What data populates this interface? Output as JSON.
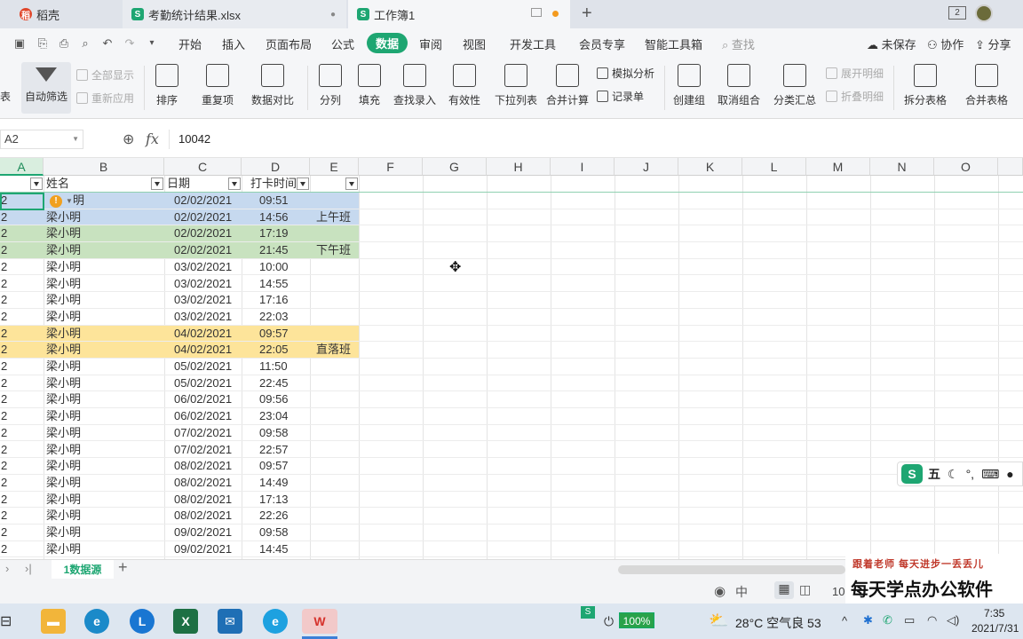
{
  "tabs": [
    {
      "label": "稻壳",
      "icon": "docer-icon",
      "color": "#e0462a"
    },
    {
      "label": "考勤统计结果.xlsx",
      "icon": "spreadsheet-icon",
      "color": "#1ea672"
    },
    {
      "label": "工作簿1",
      "icon": "spreadsheet-icon",
      "color": "#1ea672"
    }
  ],
  "window_badge": "2",
  "menu": {
    "items": [
      "开始",
      "插入",
      "页面布局",
      "公式",
      "数据",
      "审阅",
      "视图",
      "开发工具",
      "会员专享",
      "智能工具箱"
    ],
    "active": "数据",
    "search_placeholder": "查找",
    "unsaved": "未保存",
    "collab": "协作",
    "share": "分享"
  },
  "ribbon": {
    "left_partial": "表",
    "autofilter": "自动筛选",
    "show_all": "全部显示",
    "reapply": "重新应用",
    "sort": "排序",
    "duplicates": "重复项",
    "compare": "数据对比",
    "split_col": "分列",
    "fill": "填充",
    "lookup": "查找录入",
    "validity": "有效性",
    "dropdown": "下拉列表",
    "consolidate": "合并计算",
    "simulate": "模拟分析",
    "record": "记录单",
    "group": "创建组",
    "ungroup": "取消组合",
    "subtotal": "分类汇总",
    "expand": "展开明细",
    "collapse": "折叠明细",
    "split_table": "拆分表格",
    "merge_table": "合并表格"
  },
  "formula_bar": {
    "name_box": "A2",
    "fx": "fx",
    "value": "10042"
  },
  "columns": [
    "A",
    "B",
    "C",
    "D",
    "E",
    "F",
    "G",
    "H",
    "I",
    "J",
    "K",
    "L",
    "M",
    "N",
    "O"
  ],
  "headers": [
    "",
    "姓名",
    "日期",
    "打卡时间",
    ""
  ],
  "rows": [
    {
      "a": "2",
      "name": "明",
      "date": "02/02/2021",
      "time": "09:51",
      "note": "",
      "bg": "#c6d9ef"
    },
    {
      "a": "2",
      "name": "梁小明",
      "date": "02/02/2021",
      "time": "14:56",
      "note": "上午班",
      "bg": "#c6d9ef"
    },
    {
      "a": "2",
      "name": "梁小明",
      "date": "02/02/2021",
      "time": "17:19",
      "note": "",
      "bg": "#c8e2bf"
    },
    {
      "a": "2",
      "name": "梁小明",
      "date": "02/02/2021",
      "time": "21:45",
      "note": "下午班",
      "bg": "#c8e2bf"
    },
    {
      "a": "2",
      "name": "梁小明",
      "date": "03/02/2021",
      "time": "10:00",
      "note": "",
      "bg": ""
    },
    {
      "a": "2",
      "name": "梁小明",
      "date": "03/02/2021",
      "time": "14:55",
      "note": "",
      "bg": ""
    },
    {
      "a": "2",
      "name": "梁小明",
      "date": "03/02/2021",
      "time": "17:16",
      "note": "",
      "bg": ""
    },
    {
      "a": "2",
      "name": "梁小明",
      "date": "03/02/2021",
      "time": "22:03",
      "note": "",
      "bg": ""
    },
    {
      "a": "2",
      "name": "梁小明",
      "date": "04/02/2021",
      "time": "09:57",
      "note": "",
      "bg": "#fde49a"
    },
    {
      "a": "2",
      "name": "梁小明",
      "date": "04/02/2021",
      "time": "22:05",
      "note": "直落班",
      "bg": "#fde49a"
    },
    {
      "a": "2",
      "name": "梁小明",
      "date": "05/02/2021",
      "time": "11:50",
      "note": "",
      "bg": ""
    },
    {
      "a": "2",
      "name": "梁小明",
      "date": "05/02/2021",
      "time": "22:45",
      "note": "",
      "bg": ""
    },
    {
      "a": "2",
      "name": "梁小明",
      "date": "06/02/2021",
      "time": "09:56",
      "note": "",
      "bg": ""
    },
    {
      "a": "2",
      "name": "梁小明",
      "date": "06/02/2021",
      "time": "23:04",
      "note": "",
      "bg": ""
    },
    {
      "a": "2",
      "name": "梁小明",
      "date": "07/02/2021",
      "time": "09:58",
      "note": "",
      "bg": ""
    },
    {
      "a": "2",
      "name": "梁小明",
      "date": "07/02/2021",
      "time": "22:57",
      "note": "",
      "bg": ""
    },
    {
      "a": "2",
      "name": "梁小明",
      "date": "08/02/2021",
      "time": "09:57",
      "note": "",
      "bg": ""
    },
    {
      "a": "2",
      "name": "梁小明",
      "date": "08/02/2021",
      "time": "14:49",
      "note": "",
      "bg": ""
    },
    {
      "a": "2",
      "name": "梁小明",
      "date": "08/02/2021",
      "time": "17:13",
      "note": "",
      "bg": ""
    },
    {
      "a": "2",
      "name": "梁小明",
      "date": "08/02/2021",
      "time": "22:26",
      "note": "",
      "bg": ""
    },
    {
      "a": "2",
      "name": "梁小明",
      "date": "09/02/2021",
      "time": "09:58",
      "note": "",
      "bg": ""
    },
    {
      "a": "2",
      "name": "梁小明",
      "date": "09/02/2021",
      "time": "14:45",
      "note": "",
      "bg": ""
    }
  ],
  "sheet_tab": "1数据源",
  "status": {
    "zoom_partial": "10"
  },
  "ime": {
    "label": "五"
  },
  "watermark": {
    "line1": "跟着老师 每天进步一丢丢儿",
    "line2": "每天学点办公软件"
  },
  "taskbar": {
    "battery": "100%",
    "weather": "28°C 空气良 53",
    "time": "7:35",
    "date": "2021/7/31"
  },
  "colors": {
    "accent": "#1ea672",
    "selection_blue": "#c6d9ef",
    "green_band": "#c8e2bf",
    "yellow_band": "#fde49a"
  }
}
